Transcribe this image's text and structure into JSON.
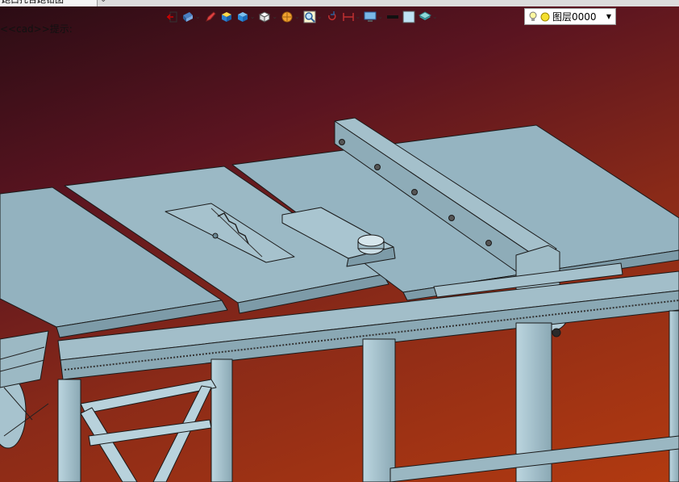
{
  "window": {
    "tab_title": "跑白托合跑钳图",
    "hint_text": "<<cad>>提示:"
  },
  "toolbar": {
    "items": [
      {
        "icon": "exit-door-icon",
        "dropdown": false
      },
      {
        "icon": "view-orientation-icon",
        "dropdown": true
      },
      {
        "icon": "pencil-icon",
        "dropdown": false
      },
      {
        "icon": "solid-box-yellow-icon",
        "dropdown": false
      },
      {
        "icon": "solid-box-blue-icon",
        "dropdown": true
      },
      {
        "icon": "white-cube-icon",
        "dropdown": true
      },
      {
        "icon": "render-sphere-icon",
        "dropdown": true
      },
      {
        "icon": "zoom-magnifier-icon",
        "dropdown": true
      },
      {
        "icon": "rotate-view-icon",
        "dropdown": false
      },
      {
        "icon": "dimension-icon",
        "dropdown": true
      },
      {
        "icon": "display-monitor-icon",
        "dropdown": true
      },
      {
        "icon": "line-style-icon",
        "dropdown": false
      },
      {
        "icon": "fill-color-icon",
        "dropdown": false
      },
      {
        "icon": "layers-stack-icon",
        "dropdown": true
      }
    ]
  },
  "layer_selector": {
    "value": "图层0000",
    "icons": [
      "lightbulb-icon",
      "sun-icon"
    ]
  },
  "colors": {
    "background_top_left": "#2a0c14",
    "background_bottom_right": "#b23a10",
    "model_face": "#93b2bf",
    "model_edge": "#1a1a1a",
    "model_light": "#c9dde5"
  }
}
